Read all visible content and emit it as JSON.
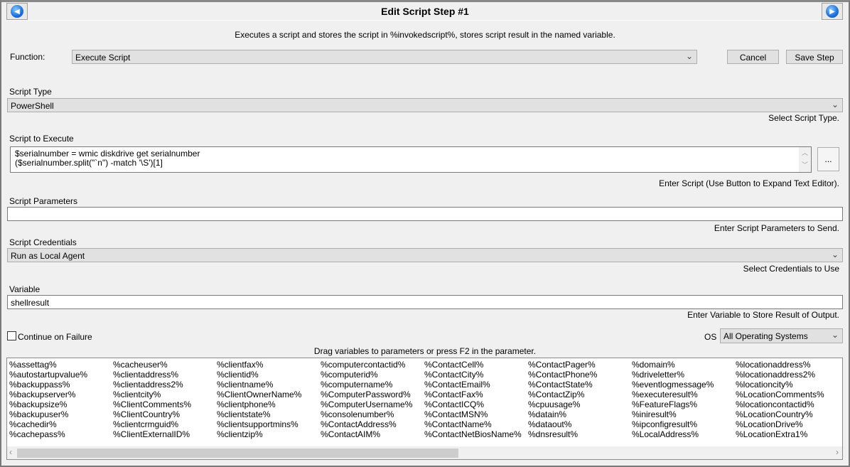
{
  "title": "Edit Script Step #1",
  "description": "Executes a script and stores the script in %invokedscript%, stores script result in the named variable.",
  "function": {
    "label": "Function:",
    "value": "Execute Script"
  },
  "buttons": {
    "cancel": "Cancel",
    "save": "Save Step",
    "ellipsis": "..."
  },
  "script_type": {
    "label": "Script Type",
    "value": "PowerShell",
    "hint": "Select Script Type."
  },
  "script": {
    "label": "Script to Execute",
    "line1": "$serialnumber = wmic diskdrive get serialnumber",
    "line2": "($serialnumber.split(\"`n\") -match '\\S')[1]",
    "hint": "Enter Script (Use Button to Expand Text Editor)."
  },
  "params": {
    "label": "Script Parameters",
    "value": "",
    "hint": "Enter Script Parameters to Send."
  },
  "credentials": {
    "label": "Script Credentials",
    "value": "Run as Local Agent",
    "hint": "Select Credentials to Use"
  },
  "variable": {
    "label": "Variable",
    "value": "shellresult",
    "hint": "Enter Variable to Store Result of Output."
  },
  "continue_on_failure": {
    "label": "Continue on Failure",
    "checked": false
  },
  "os": {
    "label": "OS",
    "value": "All Operating Systems"
  },
  "drag_hint": "Drag variables to parameters or press F2 in the parameter.",
  "variables": [
    [
      "%assettag%",
      "%autostartupvalue%",
      "%backuppass%",
      "%backupserver%",
      "%backupsize%",
      "%backupuser%",
      "%cachedir%",
      "%cachepass%"
    ],
    [
      "%cacheuser%",
      "%clientaddress%",
      "%clientaddress2%",
      "%clientcity%",
      "%ClientComments%",
      "%ClientCountry%",
      "%clientcrmguid%",
      "%ClientExternalID%"
    ],
    [
      "%clientfax%",
      "%clientid%",
      "%clientname%",
      "%ClientOwnerName%",
      "%clientphone%",
      "%clientstate%",
      "%clientsupportmins%",
      "%clientzip%"
    ],
    [
      "%computercontactid%",
      "%computerid%",
      "%computername%",
      "%ComputerPassword%",
      "%ComputerUsername%",
      "%consolenumber%",
      "%ContactAddress%",
      "%ContactAIM%"
    ],
    [
      "%ContactCell%",
      "%ContactCity%",
      "%ContactEmail%",
      "%ContactFax%",
      "%ContactICQ%",
      "%ContactMSN%",
      "%ContactName%",
      "%ContactNetBiosName%"
    ],
    [
      "%ContactPager%",
      "%ContactPhone%",
      "%ContactState%",
      "%ContactZip%",
      "%cpuusage%",
      "%datain%",
      "%dataout%",
      "%dnsresult%"
    ],
    [
      "%domain%",
      "%driveletter%",
      "%eventlogmessage%",
      "%executeresult%",
      "%FeatureFlags%",
      "%iniresult%",
      "%ipconfigresult%",
      "%LocalAddress%"
    ],
    [
      "%locationaddress%",
      "%locationaddress2%",
      "%locationcity%",
      "%LocationComments%",
      "%locationcontactid%",
      "%LocationCountry%",
      "%LocationDrive%",
      "%LocationExtra1%"
    ]
  ]
}
